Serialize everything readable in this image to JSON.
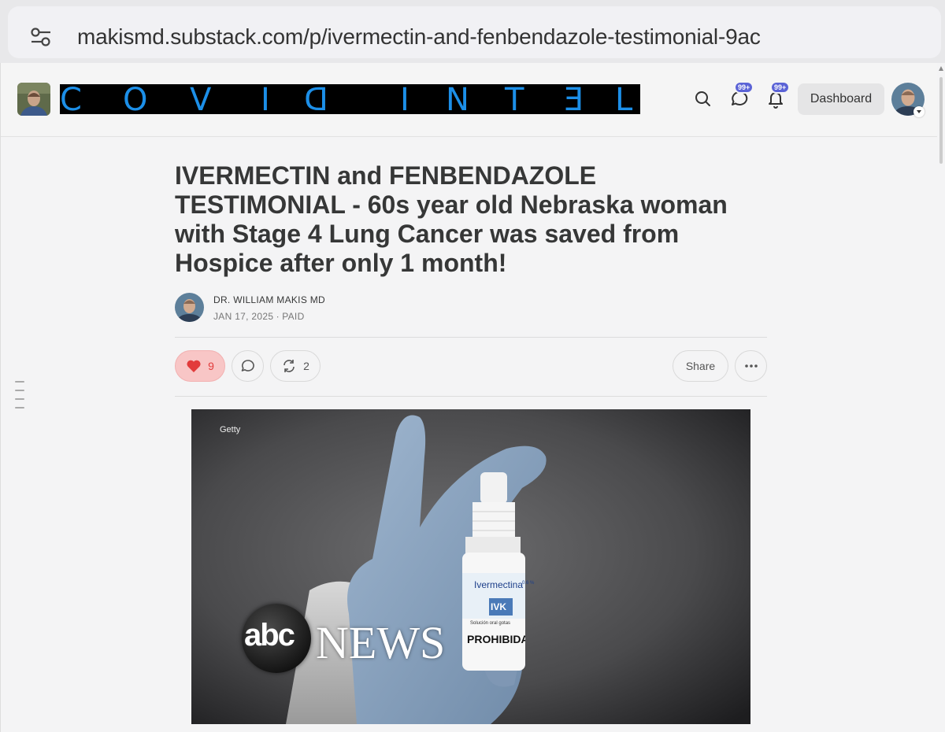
{
  "browser": {
    "url": "makismd.substack.com/p/ivermectin-and-fenbendazole-testimonial-9ac"
  },
  "header": {
    "banner_letters": [
      "C",
      "O",
      "V",
      "I",
      "D",
      "I",
      "N",
      "T",
      "Ǝ",
      "L"
    ],
    "chat_badge": "99+",
    "notif_badge": "99+",
    "dashboard_label": "Dashboard"
  },
  "post": {
    "title": "IVERMECTIN and FENBENDAZOLE TESTIMONIAL - 60s year old Nebraska woman with Stage 4 Lung Cancer was saved from Hospice after only 1 month!",
    "author": "DR. WILLIAM MAKIS MD",
    "meta": "JAN 17, 2025 ∙ PAID",
    "likes": "9",
    "restacks": "2",
    "share_label": "Share"
  },
  "image": {
    "credit": "Getty",
    "label_brand": "Ivermectina",
    "label_small": "0.6 %",
    "label_logo": "IVK",
    "label_sub": "Solución oral gotas",
    "label_warn": "PROHIBIDA SU",
    "abc_text": "abc",
    "news_text": "NEWS"
  },
  "colors": {
    "accent": "#5b63d6",
    "like_bg": "#f8c6c6",
    "like_fg": "#e23b3b",
    "banner_text": "#1c8fe8"
  }
}
